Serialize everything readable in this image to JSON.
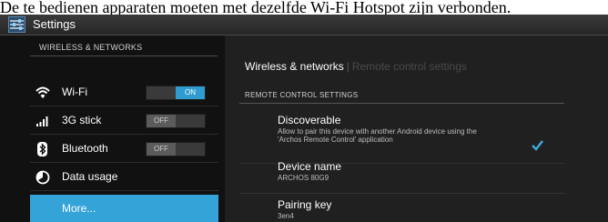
{
  "caption": "De te bedienen apparaten moeten met dezelfde Wi-Fi Hotspot zijn verbonden.",
  "app": {
    "title": "Settings",
    "icon": "settings-sliders-icon"
  },
  "sidebar": {
    "section_header": "WIRELESS & NETWORKS",
    "items": [
      {
        "label": "Wi-Fi",
        "icon": "wifi-icon",
        "toggle": "ON"
      },
      {
        "label": "3G stick",
        "icon": "signal-bars-icon",
        "toggle": "OFF"
      },
      {
        "label": "Bluetooth",
        "icon": "bluetooth-icon",
        "toggle": "OFF"
      },
      {
        "label": "Data usage",
        "icon": "data-usage-icon"
      },
      {
        "label": "More...",
        "selected": true
      }
    ]
  },
  "main": {
    "breadcrumb": {
      "active": "Wireless & networks",
      "inactive": "Remote control settings"
    },
    "section_header": "REMOTE CONTROL SETTINGS",
    "settings": [
      {
        "title": "Discoverable",
        "desc_line1": "Allow to pair this device with another Android device using the",
        "desc_line2": "'Archos Remote Control' application",
        "checked": true
      },
      {
        "title": "Device name",
        "value": "ARCHOS 80G9"
      },
      {
        "title": "Pairing key",
        "value": "3en4"
      }
    ]
  },
  "colors": {
    "accent": "#34a4d8",
    "toggle_on": "#2f9bd0",
    "checkbox": "#3fa9e0"
  }
}
